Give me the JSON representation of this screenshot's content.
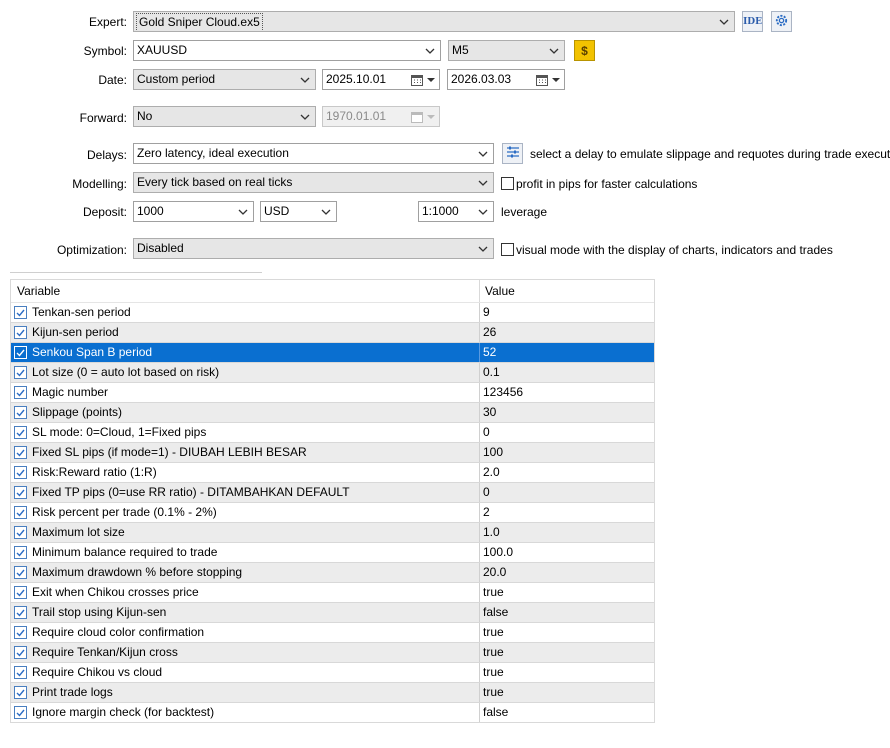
{
  "expert": {
    "label": "Expert:",
    "value": "Gold Sniper Cloud.ex5",
    "ide_label": "IDE"
  },
  "symbol": {
    "label": "Symbol:",
    "value": "XAUUSD",
    "timeframe": "M5"
  },
  "date": {
    "label": "Date:",
    "mode": "Custom period",
    "from": "2025.10.01",
    "to": "2026.03.03"
  },
  "forward": {
    "label": "Forward:",
    "mode": "No",
    "date": "1970.01.01"
  },
  "delays": {
    "label": "Delays:",
    "value": "Zero latency, ideal execution",
    "hint": "select a delay to emulate slippage and requotes during trade execution"
  },
  "modelling": {
    "label": "Modelling:",
    "value": "Every tick based on real ticks",
    "checkbox_label": "profit in pips for faster calculations"
  },
  "deposit": {
    "label": "Deposit:",
    "amount": "1000",
    "currency": "USD",
    "leverage": "1:1000",
    "leverage_label": "leverage"
  },
  "optimization": {
    "label": "Optimization:",
    "value": "Disabled",
    "checkbox_label": "visual mode with the display of charts, indicators and trades"
  },
  "table": {
    "headers": {
      "variable": "Variable",
      "value": "Value"
    },
    "rows": [
      {
        "name": "Tenkan-sen period",
        "value": "9"
      },
      {
        "name": "Kijun-sen period",
        "value": "26"
      },
      {
        "name": "Senkou Span B period",
        "value": "52"
      },
      {
        "name": "Lot size (0 = auto lot based on risk)",
        "value": "0.1"
      },
      {
        "name": "Magic number",
        "value": "123456"
      },
      {
        "name": "Slippage (points)",
        "value": "30"
      },
      {
        "name": "SL mode: 0=Cloud, 1=Fixed pips",
        "value": "0"
      },
      {
        "name": "Fixed SL pips (if mode=1) - DIUBAH LEBIH BESAR",
        "value": "100"
      },
      {
        "name": "Risk:Reward ratio (1:R)",
        "value": "2.0"
      },
      {
        "name": "Fixed TP pips (0=use RR ratio) - DITAMBAHKAN DEFAULT",
        "value": "0"
      },
      {
        "name": "Risk percent per trade (0.1% - 2%)",
        "value": "2"
      },
      {
        "name": "Maximum lot size",
        "value": "1.0"
      },
      {
        "name": "Minimum balance required to trade",
        "value": "100.0"
      },
      {
        "name": "Maximum drawdown % before stopping",
        "value": "20.0"
      },
      {
        "name": "Exit when Chikou crosses price",
        "value": "true"
      },
      {
        "name": "Trail stop using Kijun-sen",
        "value": "false"
      },
      {
        "name": "Require cloud color confirmation",
        "value": "true"
      },
      {
        "name": "Require Tenkan/Kijun cross",
        "value": "true"
      },
      {
        "name": "Require Chikou vs cloud",
        "value": "true"
      },
      {
        "name": "Print trade logs",
        "value": "true"
      },
      {
        "name": "Ignore margin check (for backtest)",
        "value": "false"
      }
    ],
    "selected_row": 2
  },
  "colors": {
    "selection": "#0a6fd0",
    "alt_row": "#ececec",
    "accent": "#2b6cc4",
    "symbol_button": "#f2c200"
  }
}
